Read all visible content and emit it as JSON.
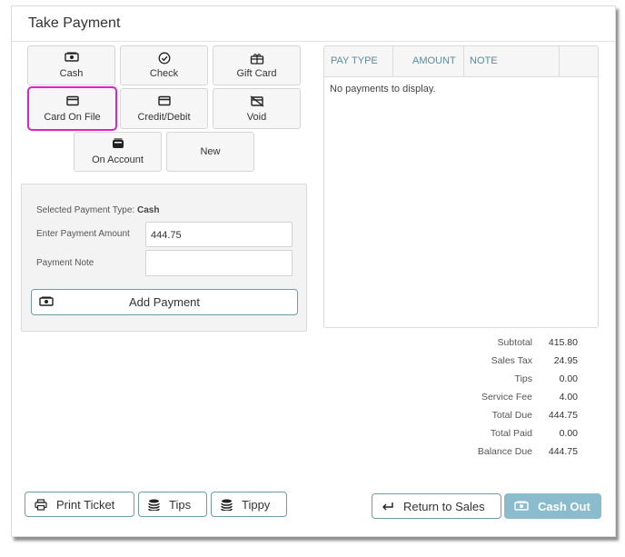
{
  "title": "Take Payment",
  "payment_types": [
    {
      "label": "Cash",
      "icon": "cash-icon"
    },
    {
      "label": "Check",
      "icon": "check-circle-icon"
    },
    {
      "label": "Gift Card",
      "icon": "gift-card-icon"
    },
    {
      "label": "Card On File",
      "icon": "credit-card-icon"
    },
    {
      "label": "Credit/Debit",
      "icon": "credit-card-icon"
    },
    {
      "label": "Void",
      "icon": "void-card-icon"
    },
    {
      "label": "On Account",
      "icon": "wallet-icon"
    },
    {
      "label": "New",
      "icon": ""
    }
  ],
  "selected_type_button": "Card On File",
  "entry": {
    "selected_label": "Selected Payment Type:",
    "selected_value": "Cash",
    "amount_label": "Enter Payment Amount",
    "amount_value": "444.75",
    "note_label": "Payment Note",
    "note_value": "",
    "add_button": "Add Payment"
  },
  "payments_table": {
    "columns": [
      "PAY TYPE",
      "AMOUNT",
      "NOTE"
    ],
    "empty_text": "No payments to display."
  },
  "summary": [
    {
      "label": "Subtotal",
      "value": "415.80"
    },
    {
      "label": "Sales Tax",
      "value": "24.95"
    },
    {
      "label": "Tips",
      "value": "0.00"
    },
    {
      "label": "Service Fee",
      "value": "4.00"
    },
    {
      "label": "Total Due",
      "value": "444.75"
    },
    {
      "label": "Total Paid",
      "value": "0.00"
    },
    {
      "label": "Balance Due",
      "value": "444.75"
    }
  ],
  "footer": {
    "print_ticket": "Print Ticket",
    "tips": "Tips",
    "tippy": "Tippy",
    "return_to_sales": "Return to Sales",
    "cash_out": "Cash Out"
  },
  "colors": {
    "accent": "#6f9cab",
    "highlight": "#e020c8",
    "cash_out_bg": "#8bbccd",
    "header_text": "#5b8ba0"
  }
}
